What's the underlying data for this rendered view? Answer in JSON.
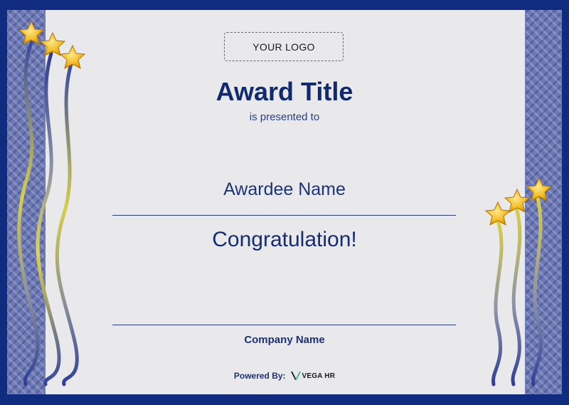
{
  "certificate": {
    "logo_placeholder": "YOUR LOGO",
    "title": "Award Title",
    "presented_text": "is presented to",
    "awardee_name": "Awardee Name",
    "message": "Congratulation!",
    "company_name": "Company Name"
  },
  "footer": {
    "powered_by_label": "Powered By:",
    "brand_name": "VEGA HR"
  },
  "colors": {
    "border_blue": "#0f2c80",
    "panel_blue": "#6c79b5",
    "paper": "#e9e9ec",
    "title_navy": "#0f2a6e",
    "star_gold": "#f2b91e"
  },
  "icons": {
    "decoration_left": "stars-with-ribbons",
    "decoration_right": "stars-with-ribbons",
    "brand_mark": "vega-hr-logo"
  }
}
